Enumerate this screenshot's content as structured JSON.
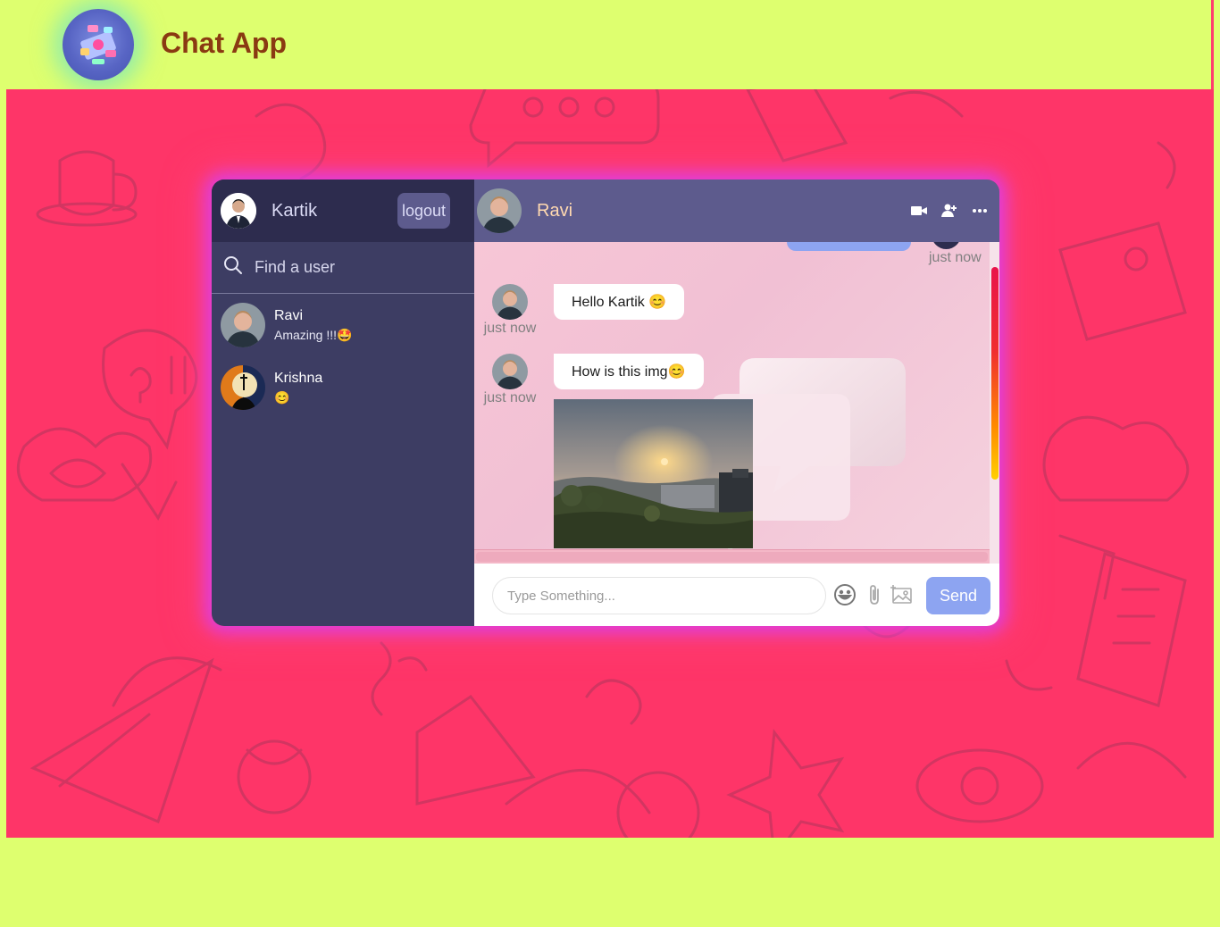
{
  "header": {
    "title": "Chat App",
    "logo_icon": "app-logo-icon"
  },
  "sidebar": {
    "current_user": {
      "name": "Kartik"
    },
    "logout_label": "logout",
    "search": {
      "placeholder": "Find a user",
      "value": ""
    },
    "chats": [
      {
        "name": "Ravi",
        "last_message": "Amazing !!!🤩"
      },
      {
        "name": "Krishna",
        "last_message": "😊"
      }
    ]
  },
  "chat": {
    "contact_name": "Ravi",
    "header_icons": [
      "video-camera-icon",
      "add-user-icon",
      "more-icon"
    ],
    "messages": [
      {
        "owner": true,
        "time": "just now"
      },
      {
        "owner": false,
        "text": "Hello Kartik 😊",
        "time": "just now"
      },
      {
        "owner": false,
        "text": "How is this img😊",
        "time": "just now",
        "image": "sunset-landscape"
      }
    ]
  },
  "input": {
    "placeholder": "Type Something...",
    "value": "",
    "send_label": "Send",
    "tools": [
      "emoji-icon",
      "attach-icon",
      "image-icon"
    ]
  },
  "colors": {
    "lime": "#deff6f",
    "pink": "#fe3568",
    "sidebar": "#3d3d63",
    "navbar": "#2d2c4e",
    "header": "#5d5b8d",
    "accent": "#8da4f1",
    "title": "#8a3a12"
  }
}
